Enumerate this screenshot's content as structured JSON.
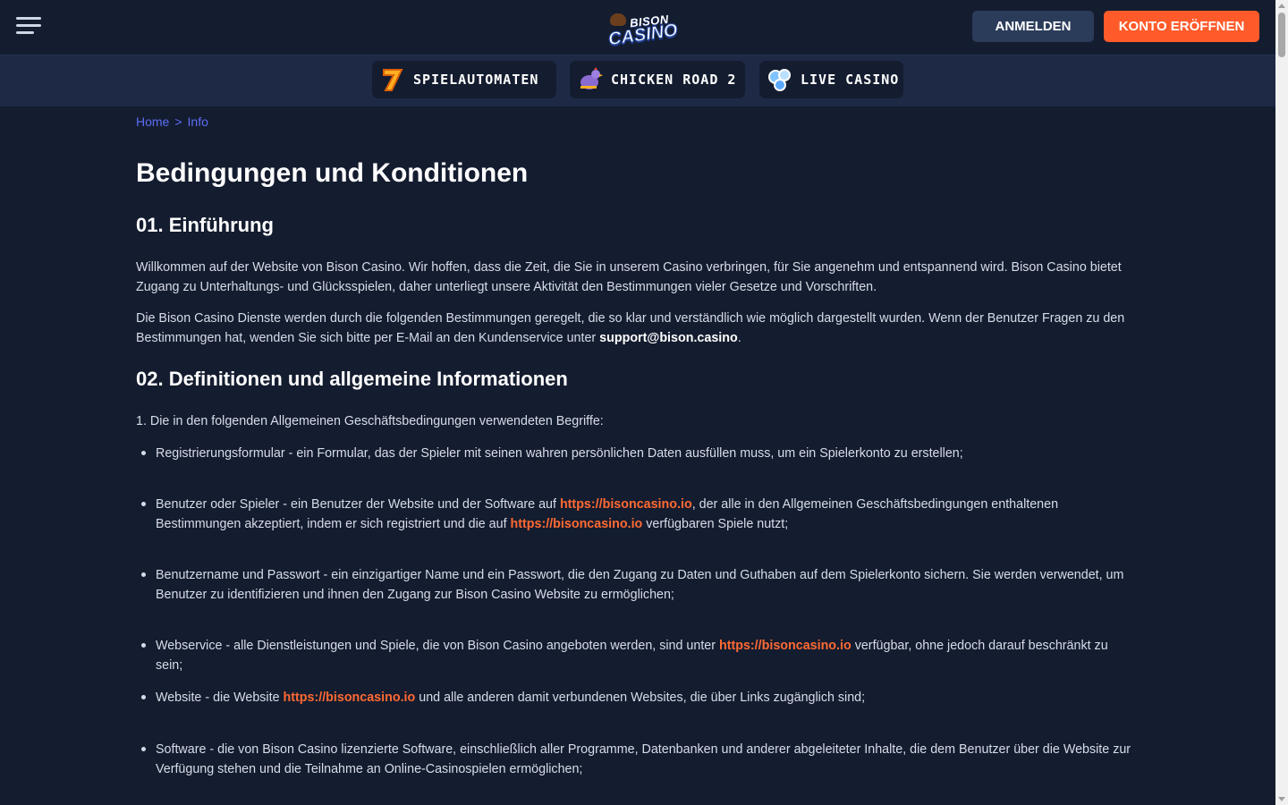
{
  "header": {
    "logo_top": "BISON",
    "logo_bottom": "CASINO",
    "login_label": "ANMELDEN",
    "register_label": "KONTO ERÖFFNEN"
  },
  "categories": [
    {
      "label": "SPIELAUTOMATEN",
      "icon": "seven-icon"
    },
    {
      "label": "CHICKEN ROAD 2",
      "icon": "chicken-icon"
    },
    {
      "label": "LIVE CASINO",
      "icon": "poker-chips-icon"
    }
  ],
  "breadcrumb": {
    "home": "Home",
    "separator": ">",
    "current": "Info"
  },
  "main": {
    "title": "Bedingungen und Konditionen",
    "section1": {
      "heading": "01. Einführung",
      "p1": "Willkommen auf der Website von Bison Casino. Wir hoffen, dass die Zeit, die Sie in unserem Casino verbringen, für Sie angenehm und entspannend wird. Bison Casino bietet Zugang zu Unterhaltungs- und Glücksspielen, daher unterliegt unsere Aktivität den Bestimmungen vieler Gesetze und Vorschriften.",
      "p2_before": "Die Bison Casino Dienste werden durch die folgenden Bestimmungen geregelt, die so klar und verständlich wie möglich dargestellt wurden. Wenn der Benutzer Fragen zu den Bestimmungen hat, wenden Sie sich bitte per E-Mail an den Kundenservice unter ",
      "p2_email": "support@bison.casino",
      "p2_after": "."
    },
    "section2": {
      "heading": "02. Definitionen und allgemeine Informationen",
      "intro": "1. Die in den folgenden Allgemeinen Geschäftsbedingungen verwendeten Begriffe:",
      "b1": "Registrierungsformular - ein Formular, das der Spieler mit seinen wahren persönlichen Daten ausfüllen muss, um ein Spielerkonto zu erstellen;",
      "b2_a": "Benutzer oder Spieler - ein Benutzer der Website und der Software auf ",
      "b2_link1": "https://bisoncasino.io",
      "b2_b": ", der alle in den Allgemeinen Geschäftsbedingungen enthaltenen Bestimmungen akzeptiert, indem er sich registriert und die auf ",
      "b2_link2": "https://bisoncasino.io",
      "b2_c": " verfügbaren Spiele nutzt;",
      "b3": "Benutzername und Passwort - ein einzigartiger Name und ein Passwort, die den Zugang zu Daten und Guthaben auf dem Spielerkonto sichern. Sie werden verwendet, um Benutzer zu identifizieren und ihnen den Zugang zur Bison Casino Website zu ermöglichen;",
      "b4_a": "Webservice - alle Dienstleistungen und Spiele, die von Bison Casino angeboten werden, sind unter ",
      "b4_link": "https://bisoncasino.io",
      "b4_b": " verfügbar, ohne jedoch darauf beschränkt zu sein;",
      "b5_a": "Website - die Website ",
      "b5_link": "https://bisoncasino.io",
      "b5_b": " und alle anderen damit verbundenen Websites, die über Links zugänglich sind;",
      "b6": "Software - die von Bison Casino lizenzierte Software, einschließlich aller Programme, Datenbanken und anderer abgeleiteter Inhalte, die dem Benutzer über die Website zur Verfügung stehen und die Teilnahme an Online-Casinospielen ermöglichen;"
    }
  },
  "colors": {
    "background": "#141c2f",
    "nav_bar": "#1e2a45",
    "accent_orange": "#ff5b2a",
    "link_orange": "#ff6a33",
    "breadcrumb_blue": "#5b6ef5",
    "login_button": "#2b3b5a"
  }
}
